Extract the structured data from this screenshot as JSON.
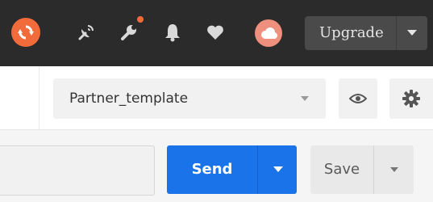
{
  "header": {
    "upgrade_label": "Upgrade",
    "icons": [
      "sync-icon",
      "satellite-icon",
      "wrench-icon",
      "bell-icon",
      "heart-icon",
      "cloud-icon",
      "chevron-down-icon"
    ],
    "colors": {
      "background": "#2b2b2b",
      "accent": "#f26b3a",
      "avatar": "#ef8f7d",
      "upgrade_bg": "#4a4a4a"
    }
  },
  "environment": {
    "selected": "Partner_template",
    "icons": [
      "chevron-down-icon",
      "eye-icon",
      "gear-icon"
    ]
  },
  "request": {
    "send_label": "Send",
    "save_label": "Save",
    "colors": {
      "send_bg": "#1a73e8",
      "save_bg": "#e9e9e9"
    }
  }
}
